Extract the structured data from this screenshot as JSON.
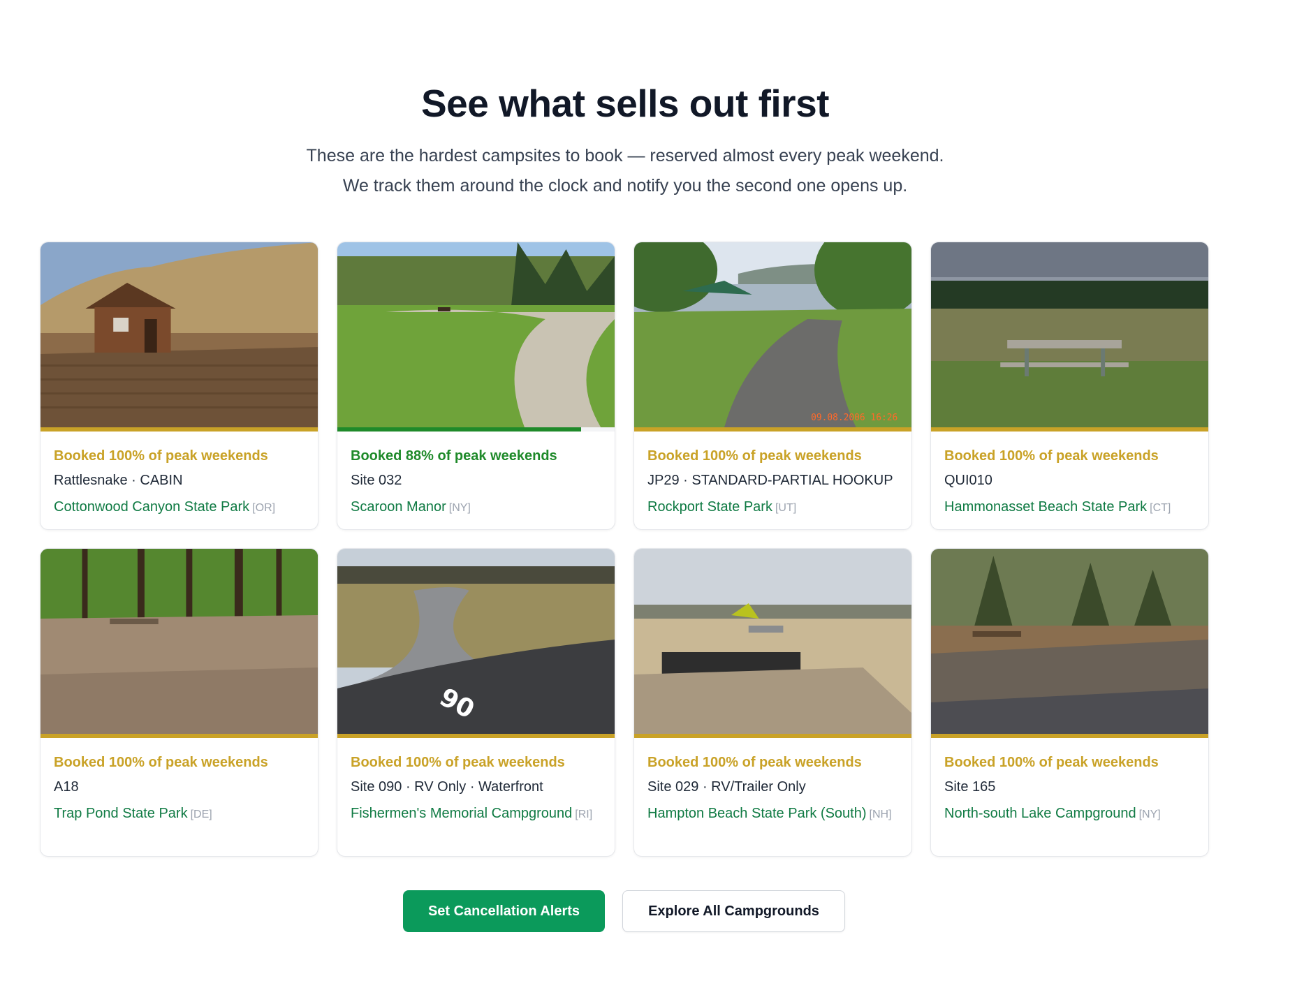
{
  "header": {
    "title": "See what sells out first",
    "subtitle_line1": "These are the hardest campsites to book — reserved almost every peak weekend.",
    "subtitle_line2": "We track them around the clock and notify you the second one opens up."
  },
  "colors": {
    "gold": "#c9a227",
    "green": "#1f8a2a",
    "park_link": "#0f7a43",
    "primary_button": "#0b9a5b"
  },
  "cards": [
    {
      "booked": "Booked 100% of peak weekends",
      "booked_pct": 100,
      "site": "Rattlesnake · CABIN",
      "park": "Cottonwood Canyon State Park",
      "state": "[OR]",
      "accent": "#c9a227",
      "photo": "cabin-desert"
    },
    {
      "booked": "Booked 88% of peak weekends",
      "booked_pct": 88,
      "site": "Site 032",
      "park": "Scaroon Manor",
      "state": "[NY]",
      "accent": "#1f8a2a",
      "photo": "grass-gravel"
    },
    {
      "booked": "Booked 100% of peak weekends",
      "booked_pct": 100,
      "site": "JP29 · STANDARD-PARTIAL HOOKUP",
      "park": "Rockport State Park",
      "state": "[UT]",
      "accent": "#c9a227",
      "photo": "lake-pavilion",
      "photo_stamp": "09.08.2006 16:26"
    },
    {
      "booked": "Booked 100% of peak weekends",
      "booked_pct": 100,
      "site": "QUI010",
      "park": "Hammonasset Beach State Park",
      "state": "[CT]",
      "accent": "#c9a227",
      "photo": "picnic-field"
    },
    {
      "booked": "Booked 100% of peak weekends",
      "booked_pct": 100,
      "site": "A18",
      "park": "Trap Pond State Park",
      "state": "[DE]",
      "accent": "#c9a227",
      "photo": "forest-site"
    },
    {
      "booked": "Booked 100% of peak weekends",
      "booked_pct": 100,
      "site": "Site 090 · RV Only · Waterfront",
      "park": "Fishermen's Memorial Campground",
      "state": "[RI]",
      "accent": "#c9a227",
      "photo": "paved-pad",
      "photo_stamp": "90"
    },
    {
      "booked": "Booked 100% of peak weekends",
      "booked_pct": 100,
      "site": "Site 029 · RV/Trailer Only",
      "park": "Hampton Beach State Park (South)",
      "state": "[NH]",
      "accent": "#c9a227",
      "photo": "beach-lot"
    },
    {
      "booked": "Booked 100% of peak weekends",
      "booked_pct": 100,
      "site": "Site 165",
      "park": "North-south Lake Campground",
      "state": "[NY]",
      "accent": "#c9a227",
      "photo": "autumn-woods"
    }
  ],
  "actions": {
    "primary": "Set Cancellation Alerts",
    "secondary": "Explore All Campgrounds"
  }
}
